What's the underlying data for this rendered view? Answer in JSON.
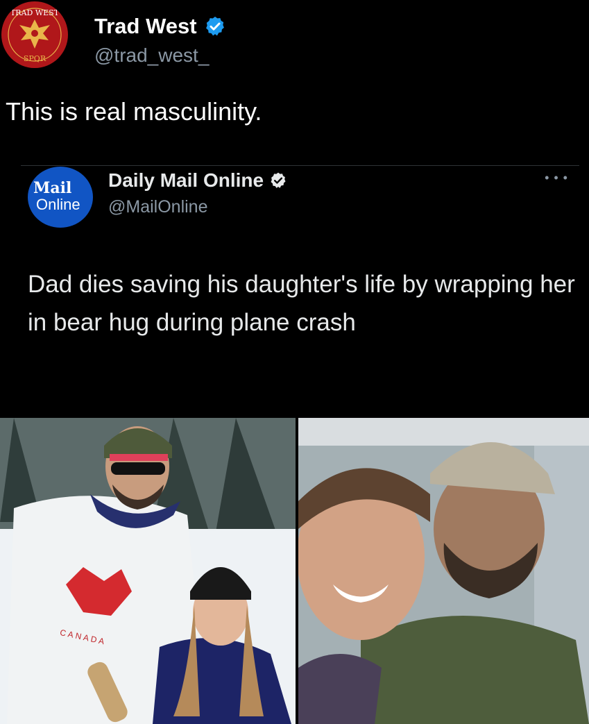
{
  "author": {
    "name": "Trad West",
    "handle": "@trad_west_",
    "avatar_text_top": "TRAD WEST",
    "avatar_text_bottom": "SPQR"
  },
  "tweet": {
    "text": "This is real masculinity."
  },
  "quoted": {
    "avatar_word1": "Mail",
    "avatar_word2": "Online",
    "name": "Daily Mail Online",
    "handle": "@MailOnline",
    "text": "Dad dies saving his daughter's life by wrapping her in bear hug during plane crash"
  },
  "photos": {
    "left_jersey_text": "CANADA"
  },
  "colors": {
    "verified_blue": "#1d9bf0",
    "mail_blue": "#1155c4",
    "avatar_red": "#b0171a"
  }
}
